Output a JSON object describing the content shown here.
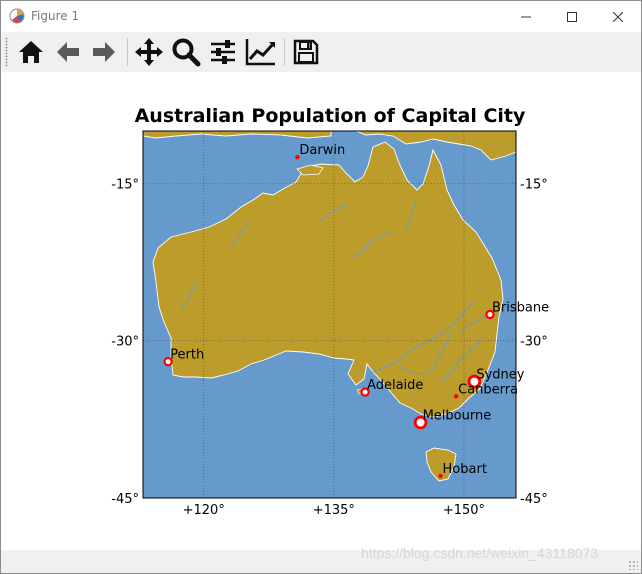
{
  "window": {
    "title": "Figure 1"
  },
  "toolbar": {
    "buttons": [
      {
        "name": "home-button",
        "icon": "home-icon"
      },
      {
        "name": "back-button",
        "icon": "arrow-left-icon"
      },
      {
        "name": "forward-button",
        "icon": "arrow-right-icon"
      },
      {
        "name": "pan-button",
        "icon": "move-icon"
      },
      {
        "name": "zoom-button",
        "icon": "magnifier-icon"
      },
      {
        "name": "subplots-button",
        "icon": "sliders-icon"
      },
      {
        "name": "customize-button",
        "icon": "line-chart-icon"
      },
      {
        "name": "save-button",
        "icon": "floppy-disk-icon"
      }
    ]
  },
  "figure": {
    "title": "Australian Population of Capital City",
    "colors": {
      "ocean": "#6699cc",
      "land": "#bc9d2c",
      "rivers": "#6699cc",
      "coast": "#ffffff",
      "marker_edge": "#ff0000",
      "marker_face": "#ffffff"
    }
  },
  "chart_data": {
    "type": "scatter",
    "title": "Australian Population of Capital City",
    "map_extent": {
      "lon": [
        113,
        156
      ],
      "lat": [
        -45,
        -10
      ]
    },
    "x_ticks": [
      "+120°",
      "+135°",
      "+150°"
    ],
    "y_ticks": [
      "-15°",
      "-30°",
      "-45°"
    ],
    "x_tick_values": [
      120,
      135,
      150
    ],
    "y_tick_values": [
      -15,
      -30,
      -45
    ],
    "grid": true,
    "points": [
      {
        "name": "Darwin",
        "lon": 130.8,
        "lat": -12.5,
        "size": "small"
      },
      {
        "name": "Brisbane",
        "lon": 153.0,
        "lat": -27.5,
        "size": "medium"
      },
      {
        "name": "Perth",
        "lon": 115.9,
        "lat": -32.0,
        "size": "medium"
      },
      {
        "name": "Sydney",
        "lon": 151.2,
        "lat": -33.9,
        "size": "large"
      },
      {
        "name": "Canberra",
        "lon": 149.1,
        "lat": -35.3,
        "size": "small"
      },
      {
        "name": "Adelaide",
        "lon": 138.6,
        "lat": -34.9,
        "size": "medium"
      },
      {
        "name": "Melbourne",
        "lon": 145.0,
        "lat": -37.8,
        "size": "large"
      },
      {
        "name": "Hobart",
        "lon": 147.3,
        "lat": -42.9,
        "size": "small"
      }
    ]
  },
  "watermark": {
    "text": "https://blog.csdn.net/weixin_43118073"
  }
}
